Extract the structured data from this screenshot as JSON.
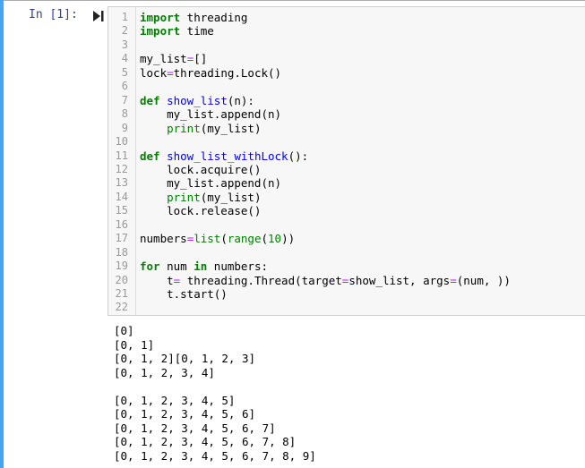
{
  "cell": {
    "prompt": "In  [1]:"
  },
  "code_lines": [
    {
      "n": "1",
      "tokens": [
        {
          "t": "import",
          "c": "kw"
        },
        {
          "t": " threading",
          "c": ""
        }
      ]
    },
    {
      "n": "2",
      "tokens": [
        {
          "t": "import",
          "c": "kw"
        },
        {
          "t": " time",
          "c": ""
        }
      ]
    },
    {
      "n": "3",
      "tokens": []
    },
    {
      "n": "4",
      "tokens": [
        {
          "t": "my_list",
          "c": ""
        },
        {
          "t": "=",
          "c": "op"
        },
        {
          "t": "[]",
          "c": ""
        }
      ]
    },
    {
      "n": "5",
      "tokens": [
        {
          "t": "lock",
          "c": ""
        },
        {
          "t": "=",
          "c": "op"
        },
        {
          "t": "threading.Lock()",
          "c": ""
        }
      ]
    },
    {
      "n": "6",
      "tokens": []
    },
    {
      "n": "7",
      "tokens": [
        {
          "t": "def",
          "c": "kw"
        },
        {
          "t": " ",
          "c": ""
        },
        {
          "t": "show_list",
          "c": "fn"
        },
        {
          "t": "(n):",
          "c": ""
        }
      ]
    },
    {
      "n": "8",
      "tokens": [
        {
          "t": "    my_list.append(n)",
          "c": ""
        }
      ]
    },
    {
      "n": "9",
      "tokens": [
        {
          "t": "    ",
          "c": ""
        },
        {
          "t": "print",
          "c": "bi"
        },
        {
          "t": "(my_list)",
          "c": ""
        }
      ]
    },
    {
      "n": "10",
      "tokens": []
    },
    {
      "n": "11",
      "tokens": [
        {
          "t": "def",
          "c": "kw"
        },
        {
          "t": " ",
          "c": ""
        },
        {
          "t": "show_list_withLock",
          "c": "fn"
        },
        {
          "t": "():",
          "c": ""
        }
      ]
    },
    {
      "n": "12",
      "tokens": [
        {
          "t": "    lock.acquire()",
          "c": ""
        }
      ]
    },
    {
      "n": "13",
      "tokens": [
        {
          "t": "    my_list.append(n)",
          "c": ""
        }
      ]
    },
    {
      "n": "14",
      "tokens": [
        {
          "t": "    ",
          "c": ""
        },
        {
          "t": "print",
          "c": "bi"
        },
        {
          "t": "(my_list)",
          "c": ""
        }
      ]
    },
    {
      "n": "15",
      "tokens": [
        {
          "t": "    lock.release()",
          "c": ""
        }
      ]
    },
    {
      "n": "16",
      "tokens": []
    },
    {
      "n": "17",
      "tokens": [
        {
          "t": "numbers",
          "c": ""
        },
        {
          "t": "=",
          "c": "op"
        },
        {
          "t": "list",
          "c": "bi"
        },
        {
          "t": "(",
          "c": ""
        },
        {
          "t": "range",
          "c": "bi"
        },
        {
          "t": "(",
          "c": ""
        },
        {
          "t": "10",
          "c": "num"
        },
        {
          "t": "))",
          "c": ""
        }
      ]
    },
    {
      "n": "18",
      "tokens": []
    },
    {
      "n": "19",
      "tokens": [
        {
          "t": "for",
          "c": "kw"
        },
        {
          "t": " num ",
          "c": ""
        },
        {
          "t": "in",
          "c": "kw"
        },
        {
          "t": " numbers:",
          "c": ""
        }
      ]
    },
    {
      "n": "20",
      "tokens": [
        {
          "t": "    t",
          "c": ""
        },
        {
          "t": "=",
          "c": "op"
        },
        {
          "t": " threading.Thread(target",
          "c": ""
        },
        {
          "t": "=",
          "c": "op"
        },
        {
          "t": "show_list, args",
          "c": ""
        },
        {
          "t": "=",
          "c": "op"
        },
        {
          "t": "(num, ))",
          "c": ""
        }
      ]
    },
    {
      "n": "21",
      "tokens": [
        {
          "t": "    t.start()",
          "c": ""
        }
      ]
    },
    {
      "n": "22",
      "tokens": []
    }
  ],
  "output_lines": [
    "[0]",
    "[0, 1]",
    "[0, 1, 2][0, 1, 2, 3]",
    "[0, 1, 2, 3, 4]",
    "",
    "[0, 1, 2, 3, 4, 5]",
    "[0, 1, 2, 3, 4, 5, 6]",
    "[0, 1, 2, 3, 4, 5, 6, 7]",
    "[0, 1, 2, 3, 4, 5, 6, 7, 8]",
    "[0, 1, 2, 3, 4, 5, 6, 7, 8, 9]"
  ],
  "colors": {
    "selected_bar": "#42a5f5",
    "prompt": "#303f9f",
    "keyword": "#008000",
    "function_name": "#0000ff",
    "operator": "#aa22ff"
  },
  "icons": {
    "run": "run-cell-icon"
  }
}
